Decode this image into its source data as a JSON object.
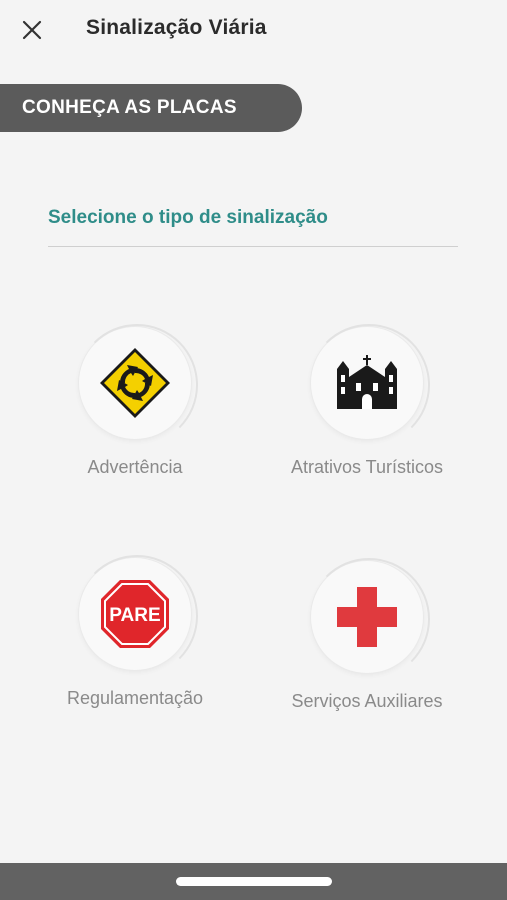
{
  "header": {
    "title": "Sinalização Viária",
    "close_icon": "close-icon"
  },
  "banner": {
    "label": "CONHEÇA AS PLACAS"
  },
  "section": {
    "title": "Selecione o tipo de sinalização"
  },
  "options": [
    {
      "label": "Advertência",
      "icon": "roundabout-warning-sign-icon"
    },
    {
      "label": "Atrativos Turísticos",
      "icon": "church-icon"
    },
    {
      "label": "Regulamentação",
      "icon": "stop-sign-icon",
      "sign_text": "PARE"
    },
    {
      "label": "Serviços Auxiliares",
      "icon": "red-cross-icon"
    }
  ],
  "colors": {
    "accent": "#2f8d89",
    "banner": "#5b5b5b",
    "warning_yellow": "#f4d000",
    "stop_red": "#e0262b",
    "cross_red": "#e03a3e"
  }
}
